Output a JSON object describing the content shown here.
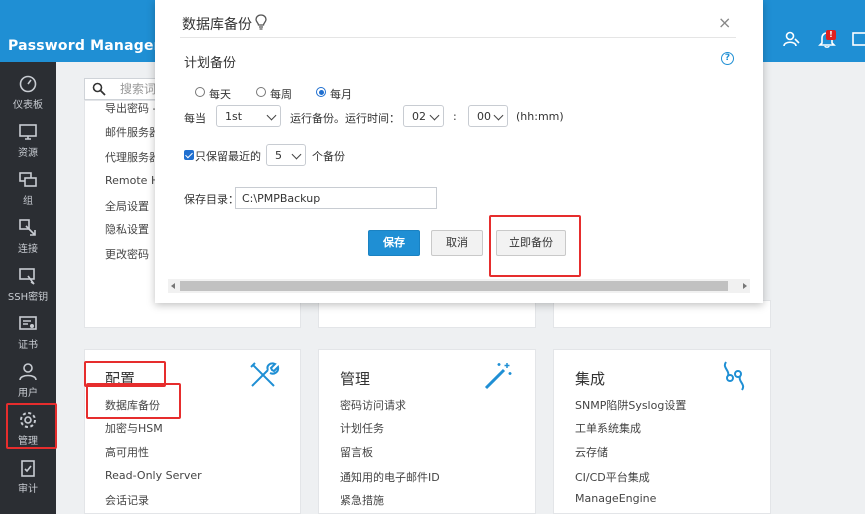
{
  "header": {
    "brand": "Password Manager Pro"
  },
  "sidebar": {
    "items": [
      {
        "label": "仪表板",
        "icon": "dashboard-icon"
      },
      {
        "label": "资源",
        "icon": "monitor-icon"
      },
      {
        "label": "组",
        "icon": "group-icon"
      },
      {
        "label": "连接",
        "icon": "connect-icon"
      },
      {
        "label": "SSH密钥",
        "icon": "ssh-key-icon"
      },
      {
        "label": "证书",
        "icon": "certificate-icon"
      },
      {
        "label": "用户",
        "icon": "user-icon"
      },
      {
        "label": "管理",
        "icon": "gear-icon"
      },
      {
        "label": "审计",
        "icon": "audit-icon"
      }
    ]
  },
  "background": {
    "search_placeholder": "搜索词",
    "top_list": [
      "导出密码 -",
      "邮件服务器",
      "代理服务器",
      "Remote He",
      "全局设置",
      "隐私设置",
      "更改密码"
    ],
    "config_card": {
      "title": "配置",
      "items": [
        "数据库备份",
        "加密与HSM",
        "高可用性",
        "Read-Only Server",
        "会话记录"
      ]
    },
    "manage_card": {
      "title": "管理",
      "items": [
        "密码访问请求",
        "计划任务",
        "留言板",
        "通知用的电子邮件ID",
        "紧急措施"
      ]
    },
    "integration_card": {
      "title": "集成",
      "items": [
        "SNMP陷阱Syslog设置",
        "工单系统集成",
        "云存储",
        "CI/CD平台集成",
        "ManageEngine"
      ]
    }
  },
  "modal": {
    "title": "数据库备份",
    "close": "×",
    "section_title": "计划备份",
    "help": "?",
    "frequency": {
      "options": [
        "每天",
        "每周",
        "每月"
      ],
      "selected": "每月"
    },
    "every_label": "每当",
    "day_select": "1st",
    "run_label": "运行备份。运行时间：",
    "hour_select": "02",
    "time_sep": ":",
    "minute_select": "00",
    "time_format": "(hh:mm)",
    "retain_label": "只保留最近的",
    "retain_count": "5",
    "retain_unit": "个备份",
    "dir_label": "保存目录：",
    "dir_value": "C:\\PMPBackup",
    "buttons": {
      "save": "保存",
      "cancel": "取消",
      "backup_now": "立即备份"
    }
  },
  "colors": {
    "header": "#1f8fd4",
    "sidebar": "#2b2e33",
    "primary": "#1f8fd4",
    "highlight": "#e62d2d"
  }
}
